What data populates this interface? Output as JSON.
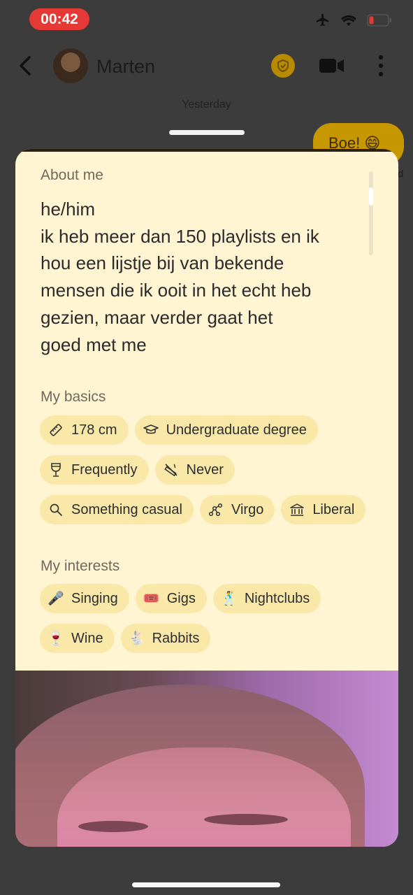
{
  "status_bar": {
    "time": "00:42"
  },
  "header": {
    "name": "Marten",
    "date_divider": "Yesterday"
  },
  "chat": {
    "bubble_text": "Boe! 😄",
    "bubble_tail": "d"
  },
  "card": {
    "about": {
      "label": "About me",
      "lines": [
        "he/him",
        "ik heb meer dan 150 playlists en ik",
        "hou een lijstje bij van bekende",
        "mensen die ik ooit in het echt heb",
        "gezien, maar verder gaat het",
        "goed met me"
      ]
    },
    "basics": {
      "label": "My basics",
      "items": [
        {
          "icon": "ruler-icon",
          "label": "178 cm"
        },
        {
          "icon": "graduation-cap-icon",
          "label": "Undergraduate degree"
        },
        {
          "icon": "wine-glass-icon",
          "label": "Frequently"
        },
        {
          "icon": "smoking-icon",
          "label": "Never"
        },
        {
          "icon": "search-icon",
          "label": "Something casual"
        },
        {
          "icon": "zodiac-icon",
          "label": "Virgo"
        },
        {
          "icon": "government-building-icon",
          "label": "Liberal"
        }
      ]
    },
    "interests": {
      "label": "My interests",
      "items": [
        {
          "emoji": "🎤",
          "label": "Singing"
        },
        {
          "emoji": "🎟️",
          "label": "Gigs"
        },
        {
          "emoji": "🕺",
          "label": "Nightclubs"
        },
        {
          "emoji": "🍷",
          "label": "Wine"
        },
        {
          "emoji": "🐇",
          "label": "Rabbits"
        }
      ]
    }
  },
  "colors": {
    "card_bg": "#fff5d3",
    "chip_bg": "#fae8a9",
    "badge": "#b78a00",
    "time_pill": "#e53935"
  }
}
